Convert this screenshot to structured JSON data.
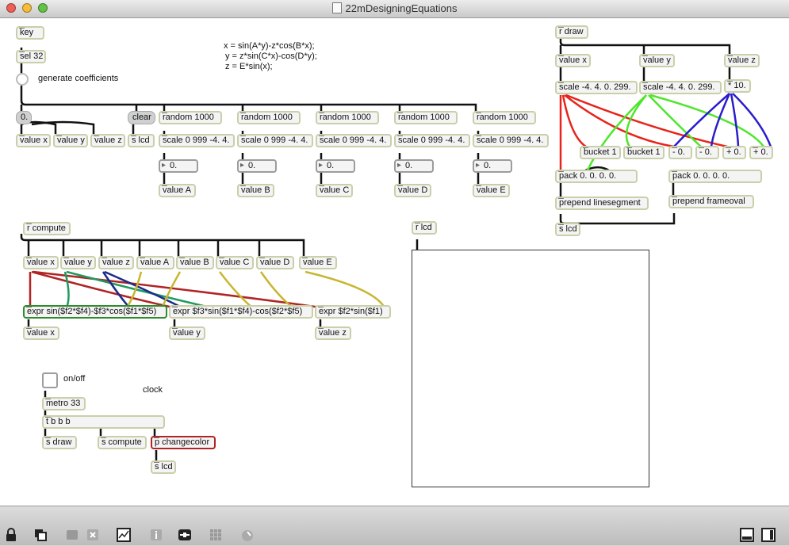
{
  "window": {
    "title": "22mDesigningEquations"
  },
  "colors": {
    "red": "#e8231b",
    "green": "#4ee62b",
    "blue": "#2a1dcc",
    "olive": "#c8b630",
    "darkred": "#b02424",
    "darkgreen": "#1f9a5e",
    "navy": "#1c2a8a"
  },
  "keygen": {
    "key": "key",
    "sel": "sel 32",
    "generate_label": "generate coefficients",
    "float0": "0.",
    "clear": "clear",
    "value_x": "value x",
    "value_y": "value y",
    "value_z": "value z",
    "s_lcd": "s lcd"
  },
  "coefficients": [
    {
      "random": "random 1000",
      "scale": "scale 0 999 -4. 4.",
      "number": "0.",
      "value": "value A"
    },
    {
      "random": "random 1000",
      "scale": "scale 0 999 -4. 4.",
      "number": "0.",
      "value": "value B"
    },
    {
      "random": "random 1000",
      "scale": "scale 0 999 -4. 4.",
      "number": "0.",
      "value": "value C"
    },
    {
      "random": "random 1000",
      "scale": "scale 0 999 -4. 4.",
      "number": "0.",
      "value": "value D"
    },
    {
      "random": "random 1000",
      "scale": "scale 0 999 -4. 4.",
      "number": "0.",
      "value": "value E"
    }
  ],
  "equations": {
    "x": "x = sin(A*y)-z*cos(B*x);",
    "y": "y = z*sin(C*x)-cos(D*y);",
    "z": "z = E*sin(x);"
  },
  "draw": {
    "r_draw": "r draw",
    "value_x": "value x",
    "value_y": "value y",
    "value_z": "value z",
    "scale_x": "scale -4. 4. 0. 299.",
    "scale_y": "scale -4. 4. 0. 299.",
    "mul10": "* 10.",
    "bucket1": "bucket 1",
    "bucket2": "bucket 1",
    "minus1": "- 0.",
    "minus2": "- 0.",
    "plus1": "+ 0.",
    "plus2": "+ 0.",
    "pack1": "pack 0. 0. 0. 0.",
    "pack2": "pack 0. 0. 0. 0.",
    "prepend1": "prepend linesegment",
    "prepend2": "prepend frameoval",
    "s_lcd": "s lcd"
  },
  "compute": {
    "r_compute": "r compute",
    "values": [
      "value x",
      "value y",
      "value z",
      "value A",
      "value B",
      "value C",
      "value D",
      "value E"
    ],
    "expr1": "expr sin($f2*$f4)-$f3*cos($f1*$f5)",
    "expr2": "expr $f3*sin($f1*$f4)-cos($f2*$f5)",
    "expr3": "expr $f2*sin($f1)",
    "out_x": "value x",
    "out_y": "value y",
    "out_z": "value z"
  },
  "clock": {
    "onoff": "on/off",
    "clock_label": "clock",
    "metro": "metro 33",
    "tbbb": "t b b b",
    "s_draw": "s draw",
    "s_compute": "s compute",
    "changecolor": "p changecolor",
    "s_lcd": "s lcd"
  },
  "lcd": {
    "r_lcd": "r lcd"
  },
  "toolbar": [
    "lock-icon",
    "presentation-icon",
    "subpatch-icon",
    "close-box-icon",
    "inspector-chart-icon",
    "info-icon",
    "connect-icon",
    "grid-icon",
    "clue-icon",
    "patcher-view-icon",
    "presentation-view-icon"
  ]
}
